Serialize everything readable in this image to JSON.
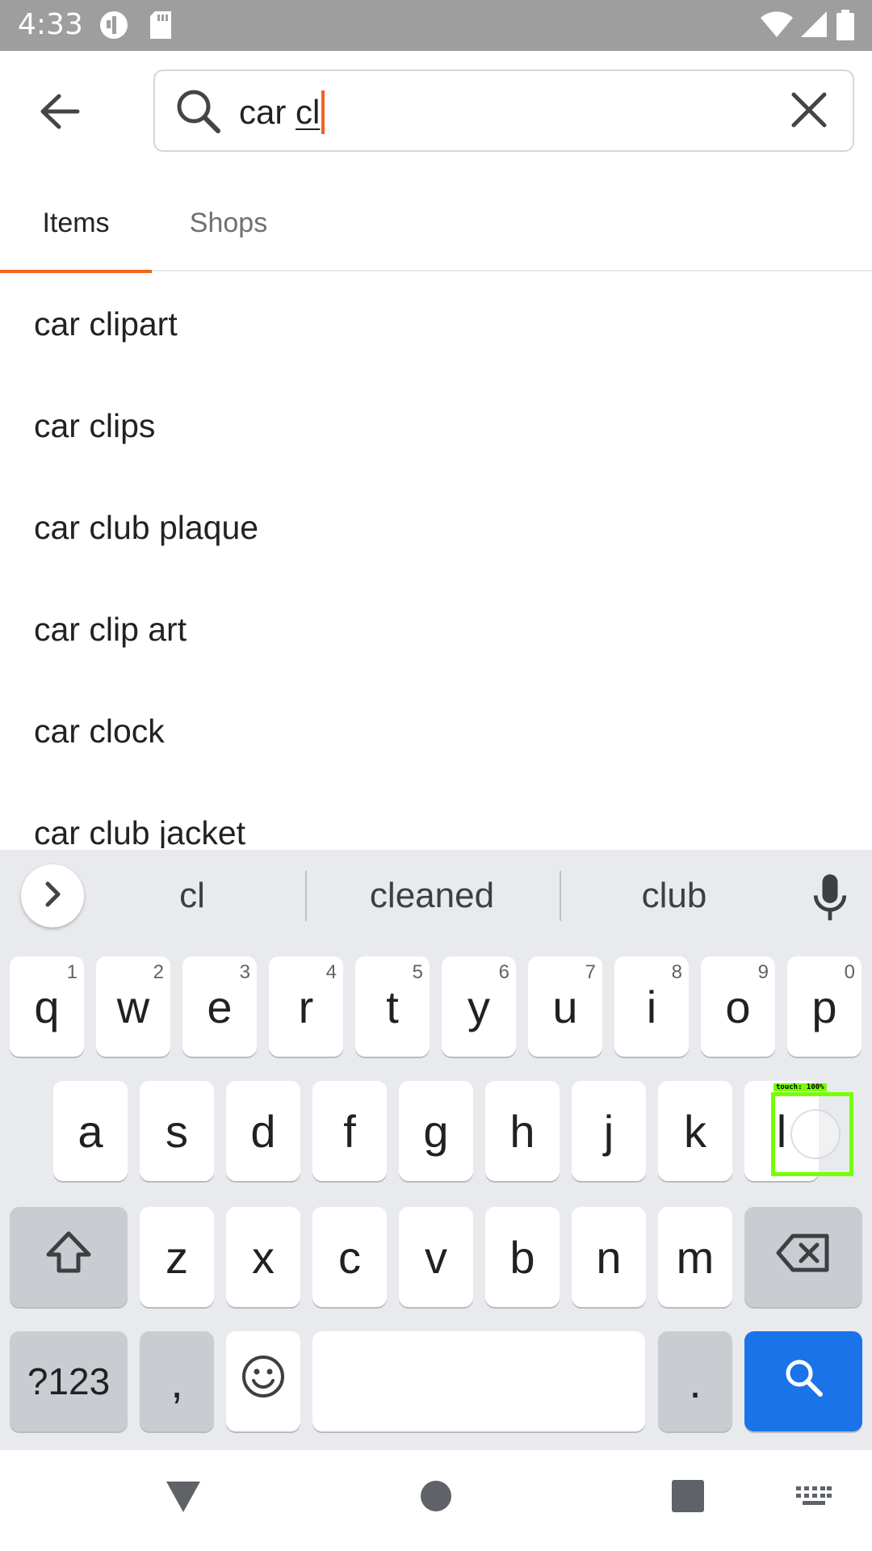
{
  "status_bar": {
    "time": "4:33",
    "icons": [
      "notification-app-icon",
      "sd-card-icon",
      "wifi-icon",
      "cell-signal-icon",
      "battery-icon"
    ]
  },
  "search": {
    "query_prefix": "car ",
    "query_composing": "cl",
    "icons": {
      "back": "arrow-left-icon",
      "search": "search-icon",
      "clear": "close-icon"
    },
    "accent_color": "#f1641e"
  },
  "tabs": [
    {
      "label": "Items",
      "selected": true
    },
    {
      "label": "Shops",
      "selected": false
    }
  ],
  "suggestions": [
    "car clipart",
    "car clips",
    "car club plaque",
    "car clip art",
    "car clock",
    "car club jacket"
  ],
  "keyboard": {
    "word_suggestions": [
      "cl",
      "cleaned",
      "club"
    ],
    "row1": [
      {
        "key": "q",
        "hint": "1"
      },
      {
        "key": "w",
        "hint": "2"
      },
      {
        "key": "e",
        "hint": "3"
      },
      {
        "key": "r",
        "hint": "4"
      },
      {
        "key": "t",
        "hint": "5"
      },
      {
        "key": "y",
        "hint": "6"
      },
      {
        "key": "u",
        "hint": "7"
      },
      {
        "key": "i",
        "hint": "8"
      },
      {
        "key": "o",
        "hint": "9"
      },
      {
        "key": "p",
        "hint": "0"
      }
    ],
    "row2": [
      "a",
      "s",
      "d",
      "f",
      "g",
      "h",
      "j",
      "k",
      "l"
    ],
    "row3": [
      "z",
      "x",
      "c",
      "v",
      "b",
      "n",
      "m"
    ],
    "symbols_label": "?123",
    "comma_label": ",",
    "period_label": ".",
    "search_key_color": "#1a73e8"
  },
  "touch_indicator": {
    "label": "touch: 100%",
    "target_key": "l"
  },
  "nav_bar": {
    "icons": [
      "back-triangle-icon",
      "home-circle-icon",
      "recents-square-icon",
      "keyboard-switch-icon"
    ]
  }
}
